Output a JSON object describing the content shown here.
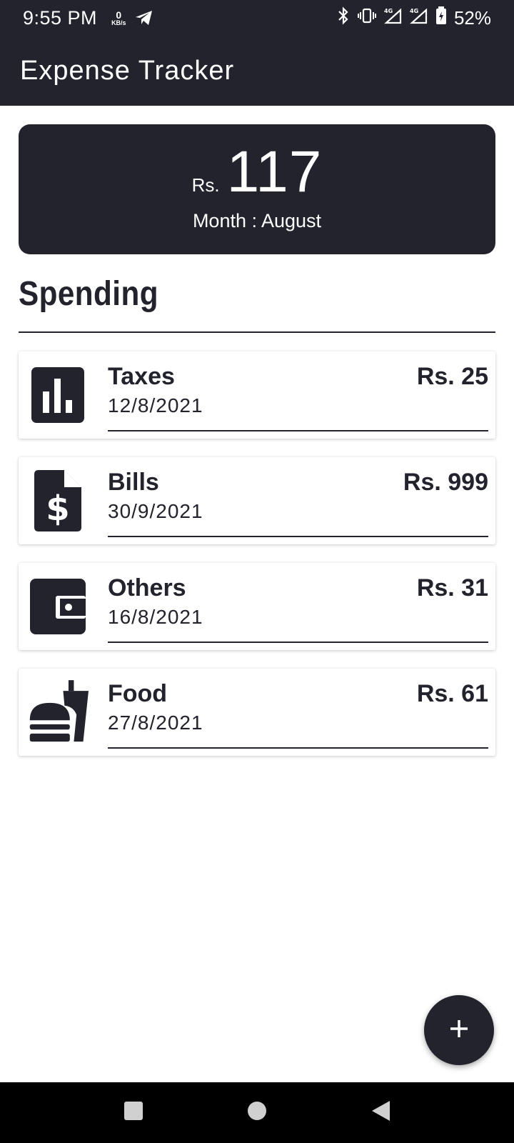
{
  "status_bar": {
    "time": "9:55 PM",
    "speed_value": "0",
    "speed_unit": "KB/s",
    "battery": "52%",
    "icons": [
      "telegram-icon",
      "bluetooth-icon",
      "vibrate-icon",
      "signal-4g-icon",
      "signal-4g-icon",
      "battery-charging-icon"
    ]
  },
  "app_bar": {
    "title": "Expense Tracker"
  },
  "total_card": {
    "currency": "Rs.",
    "amount": "117",
    "month_label": "Month : August"
  },
  "spending": {
    "heading": "Spending"
  },
  "expenses": [
    {
      "title": "Taxes",
      "date": "12/8/2021",
      "amount": "Rs. 25",
      "icon": "bar-chart-icon"
    },
    {
      "title": "Bills",
      "date": "30/9/2021",
      "amount": "Rs. 999",
      "icon": "bill-document-icon"
    },
    {
      "title": "Others",
      "date": "16/8/2021",
      "amount": "Rs. 31",
      "icon": "wallet-icon"
    },
    {
      "title": "Food",
      "date": "27/8/2021",
      "amount": "Rs. 61",
      "icon": "fastfood-icon"
    }
  ],
  "fab": {
    "icon": "plus-icon"
  },
  "nav_bar": {
    "icons": [
      "recents-square-icon",
      "home-circle-icon",
      "back-triangle-icon"
    ]
  },
  "colors": {
    "primary_dark": "#22232c",
    "background": "#ffffff",
    "nav_bar": "#000000"
  }
}
